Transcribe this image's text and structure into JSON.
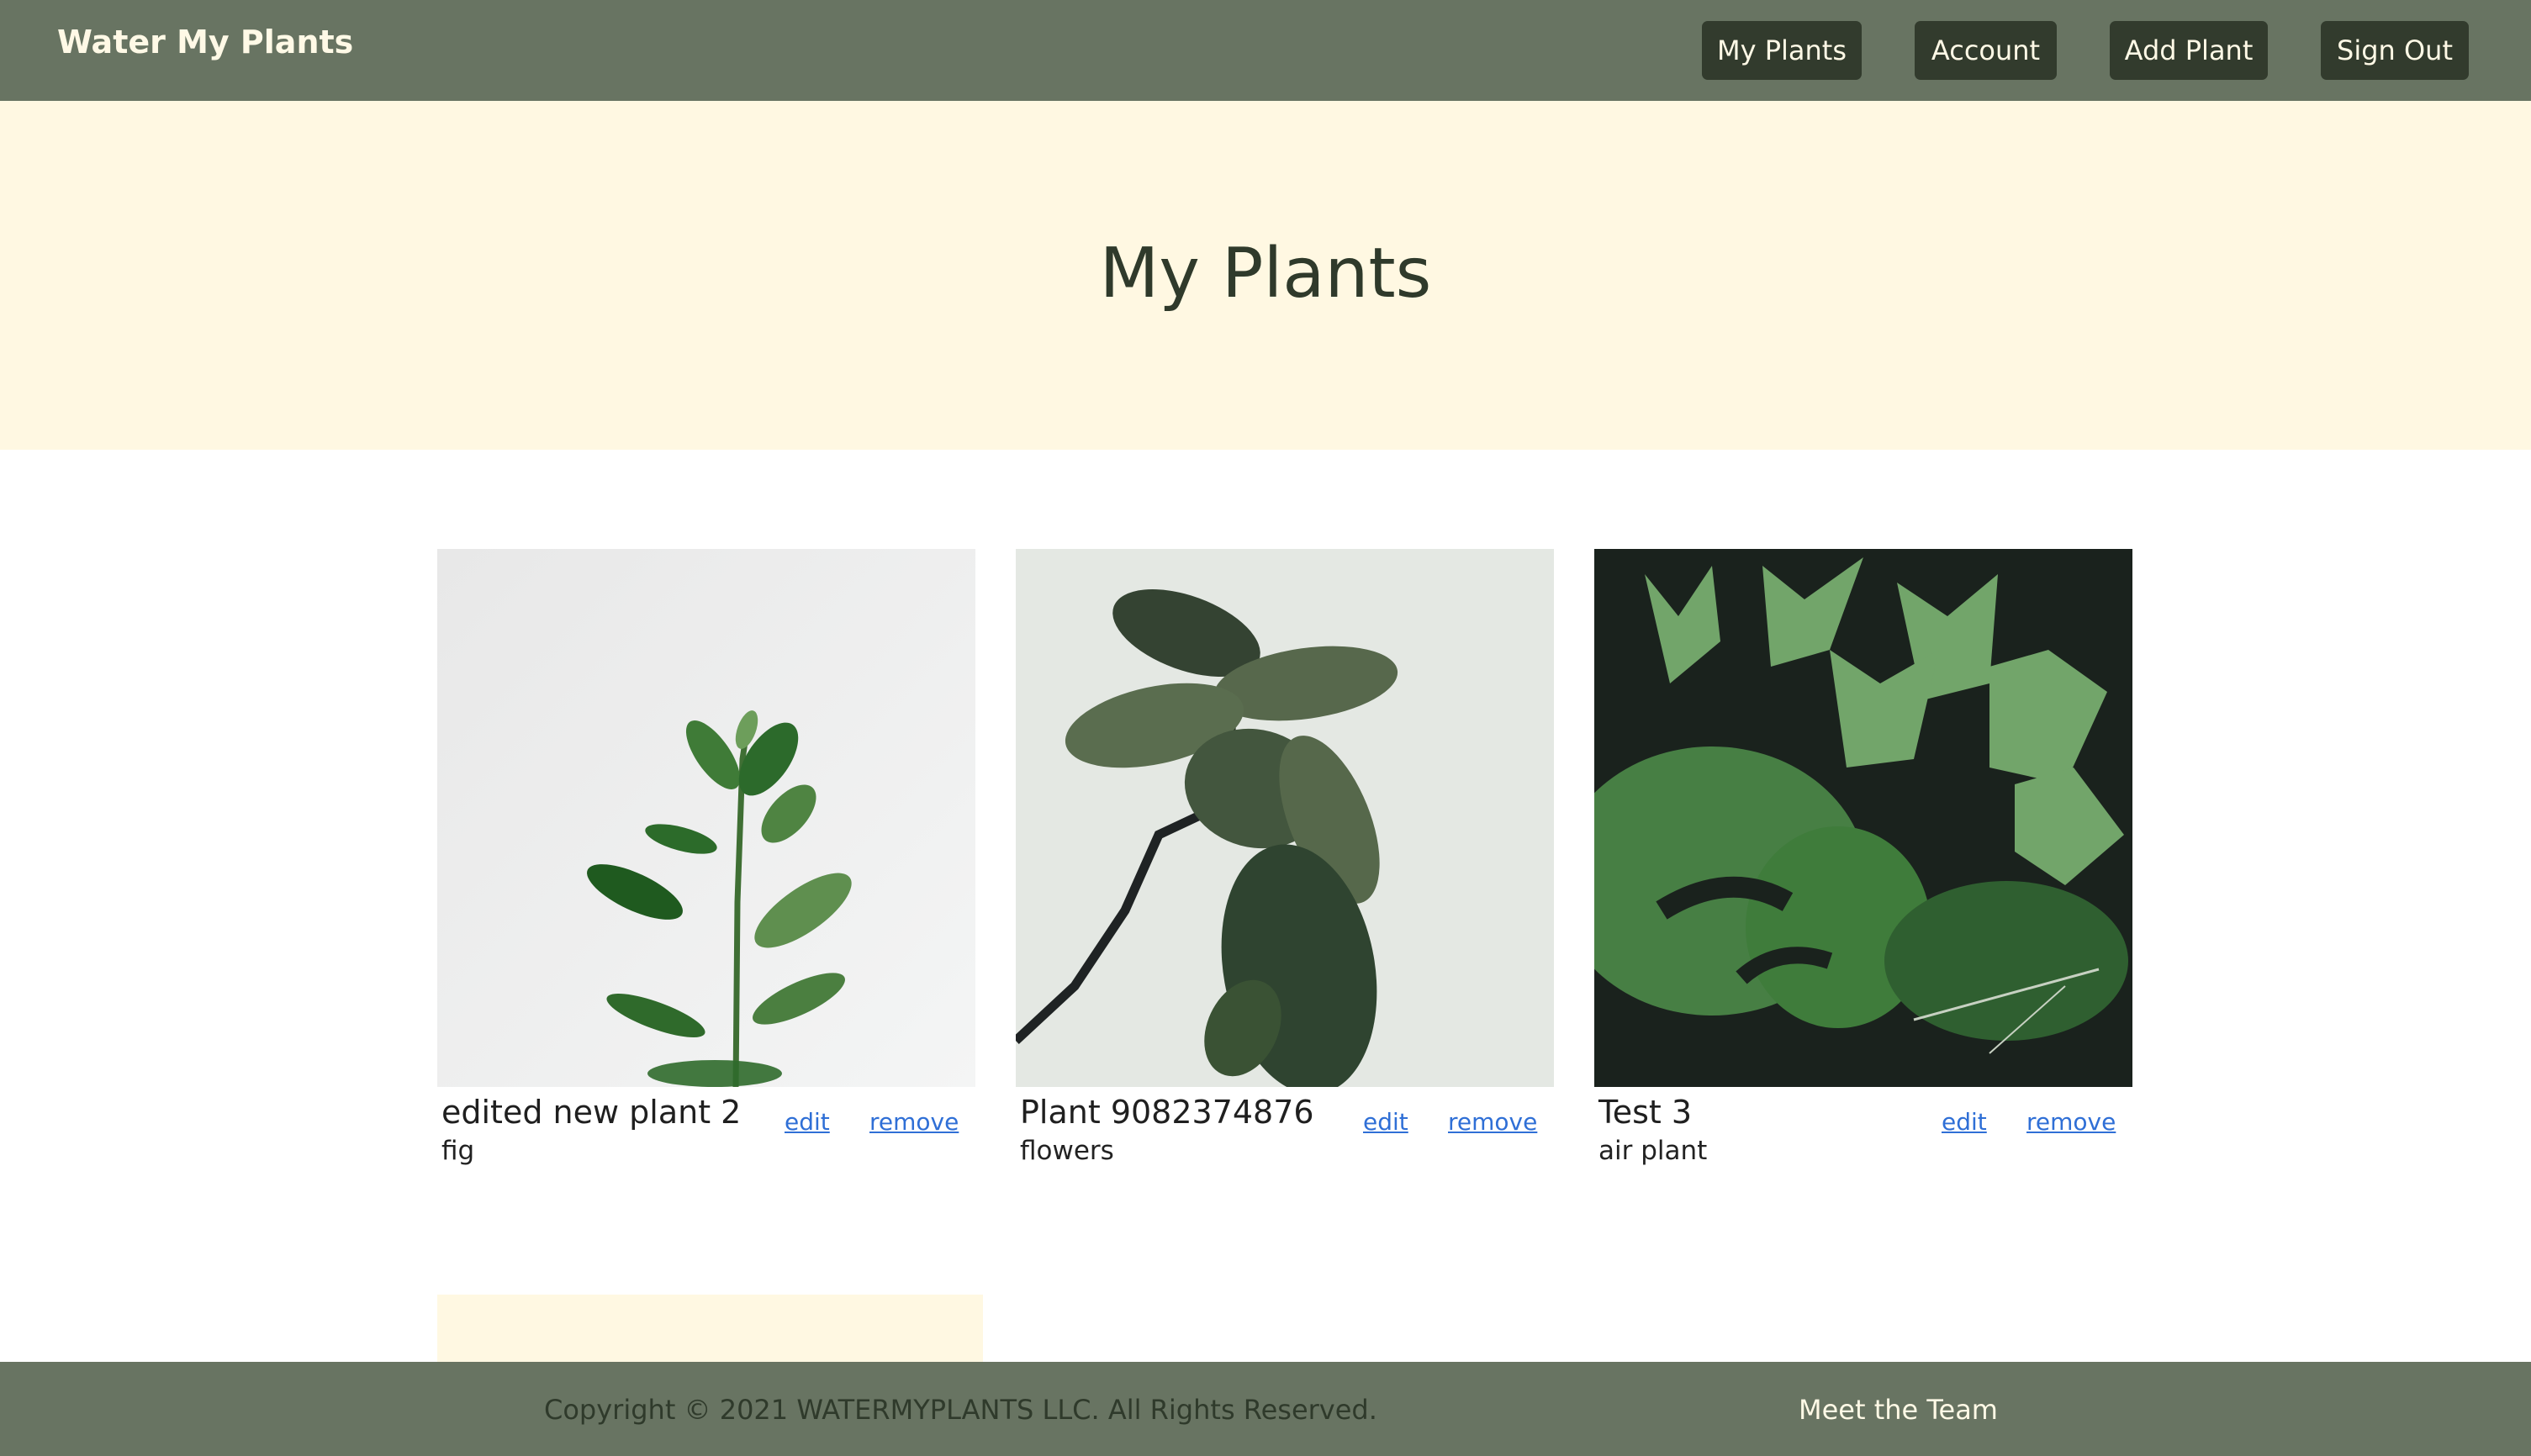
{
  "header": {
    "brand": "Water My Plants",
    "nav": [
      {
        "label": "My Plants"
      },
      {
        "label": "Account"
      },
      {
        "label": "Add Plant"
      },
      {
        "label": "Sign Out"
      }
    ]
  },
  "hero": {
    "title": "My Plants"
  },
  "plants": [
    {
      "name": "edited new plant 2",
      "type": "fig",
      "edit_label": "edit",
      "remove_label": "remove"
    },
    {
      "name": "Plant 9082374876",
      "type": "flowers",
      "edit_label": "edit",
      "remove_label": "remove"
    },
    {
      "name": "Test 3",
      "type": "air plant",
      "edit_label": "edit",
      "remove_label": "remove"
    }
  ],
  "footer": {
    "copyright": "Copyright © 2021 WATERMYPLANTS LLC. All Rights Reserved.",
    "team_link": "Meet the Team"
  },
  "colors": {
    "header_bg": "#687462",
    "nav_button_bg": "#323b2d",
    "hero_bg": "#fff8e2",
    "link": "#2f6fd6",
    "text_cream": "#fff9e6"
  }
}
